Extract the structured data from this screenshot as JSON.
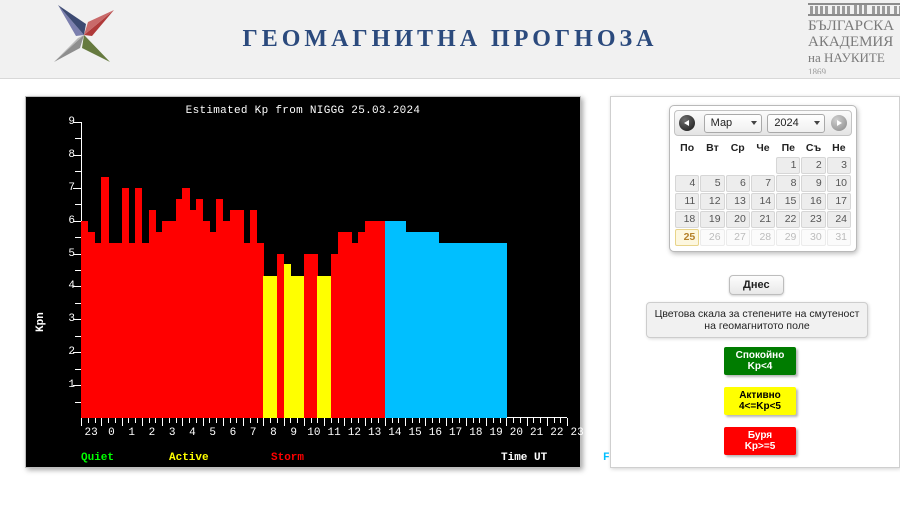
{
  "header": {
    "title": "ГЕОМАГНИТНА ПРОГНОЗА",
    "logo_icon": "four-point-star-icon",
    "bas": {
      "line1": "БЪЛГАРСКА",
      "line2": "АКАДЕМИЯ",
      "line3": "на НАУКИТЕ",
      "year": "1869",
      "building_icon": "bas-building-icon"
    }
  },
  "chart_data": {
    "type": "bar",
    "title": "Estimated Kp from NIGGG 25.03.2024",
    "xlabel": "Time UT",
    "ylabel": "Kpn",
    "ylim": [
      0,
      9
    ],
    "yticks": [
      1,
      2,
      3,
      4,
      5,
      6,
      7,
      8,
      9
    ],
    "xticks": [
      "23",
      "0",
      "1",
      "2",
      "3",
      "4",
      "5",
      "6",
      "7",
      "8",
      "9",
      "10",
      "11",
      "12",
      "13",
      "14",
      "15",
      "16",
      "17",
      "18",
      "19",
      "20",
      "21",
      "22",
      "23"
    ],
    "grid": false,
    "legend_position": "below-axis",
    "legend": [
      {
        "label": "Quiet",
        "color": "#00ff00"
      },
      {
        "label": "Active",
        "color": "#ffff00"
      },
      {
        "label": "Storm",
        "color": "#ff0000"
      },
      {
        "label": "Time UT",
        "color": "#ffffff"
      },
      {
        "label": "Forecast",
        "color": "#00bfff"
      }
    ],
    "colors": {
      "quiet": "#00ff00",
      "active": "#ffff00",
      "storm": "#ff0000",
      "forecast": "#00bfff",
      "background": "#000000",
      "axis": "#ffffff"
    },
    "bar_interval_minutes": 20,
    "start_hour_label": "23",
    "series": [
      {
        "name": "Estimated Kp",
        "values": [
          6.0,
          5.67,
          5.33,
          7.33,
          5.33,
          5.33,
          7.0,
          5.33,
          7.0,
          5.33,
          6.33,
          5.67,
          6.0,
          6.0,
          6.67,
          7.0,
          6.33,
          6.67,
          6.0,
          5.67,
          6.67,
          6.0,
          6.33,
          6.33,
          5.33,
          6.33,
          5.33,
          4.33,
          4.33,
          5.0,
          4.67,
          4.33,
          4.33,
          5.0,
          5.0,
          4.33,
          4.33,
          5.0,
          5.67,
          5.67,
          5.33,
          5.67,
          6.0,
          6.0,
          6.0
        ]
      },
      {
        "name": "Forecast Kp",
        "values": [
          6.0,
          6.0,
          6.0,
          5.67,
          5.67,
          5.67,
          5.67,
          5.67,
          5.33,
          5.33,
          5.33,
          5.33,
          5.33,
          5.33,
          5.33,
          5.33,
          5.33,
          5.33
        ]
      }
    ]
  },
  "sidebar": {
    "calendar": {
      "prev_label": "prev-month-arrow",
      "next_label": "next-month-arrow",
      "month": "Мар",
      "year": "2024",
      "weekdays": [
        "По",
        "Вт",
        "Ср",
        "Че",
        "Пе",
        "Съ",
        "Не"
      ],
      "weeks": [
        [
          {
            "d": "",
            "state": "empty"
          },
          {
            "d": "",
            "state": "empty"
          },
          {
            "d": "",
            "state": "empty"
          },
          {
            "d": "",
            "state": "empty"
          },
          {
            "d": "1",
            "state": "normal"
          },
          {
            "d": "2",
            "state": "normal"
          },
          {
            "d": "3",
            "state": "normal"
          }
        ],
        [
          {
            "d": "4",
            "state": "normal"
          },
          {
            "d": "5",
            "state": "normal"
          },
          {
            "d": "6",
            "state": "normal"
          },
          {
            "d": "7",
            "state": "normal"
          },
          {
            "d": "8",
            "state": "normal"
          },
          {
            "d": "9",
            "state": "normal"
          },
          {
            "d": "10",
            "state": "normal"
          }
        ],
        [
          {
            "d": "11",
            "state": "normal"
          },
          {
            "d": "12",
            "state": "normal"
          },
          {
            "d": "13",
            "state": "normal"
          },
          {
            "d": "14",
            "state": "normal"
          },
          {
            "d": "15",
            "state": "normal"
          },
          {
            "d": "16",
            "state": "normal"
          },
          {
            "d": "17",
            "state": "normal"
          }
        ],
        [
          {
            "d": "18",
            "state": "normal"
          },
          {
            "d": "19",
            "state": "normal"
          },
          {
            "d": "20",
            "state": "normal"
          },
          {
            "d": "21",
            "state": "normal"
          },
          {
            "d": "22",
            "state": "normal"
          },
          {
            "d": "23",
            "state": "normal"
          },
          {
            "d": "24",
            "state": "normal"
          }
        ],
        [
          {
            "d": "25",
            "state": "today"
          },
          {
            "d": "26",
            "state": "muted"
          },
          {
            "d": "27",
            "state": "muted"
          },
          {
            "d": "28",
            "state": "muted"
          },
          {
            "d": "29",
            "state": "muted"
          },
          {
            "d": "30",
            "state": "muted"
          },
          {
            "d": "31",
            "state": "muted"
          }
        ]
      ]
    },
    "today_button": "Днес",
    "scale_caption_line1": "Цветова скала за степените на смутеност",
    "scale_caption_line2": "на геомагнитото поле",
    "scale": [
      {
        "name": "Спокойно",
        "range": "Kp<4",
        "color": "#007c00",
        "text": "#ffffff"
      },
      {
        "name": "Активно",
        "range": "4<=Kp<5",
        "color": "#ffff00",
        "text": "#000000"
      },
      {
        "name": "Буря",
        "range": "Kp>=5",
        "color": "#ff0000",
        "text": "#ffffff"
      }
    ]
  }
}
